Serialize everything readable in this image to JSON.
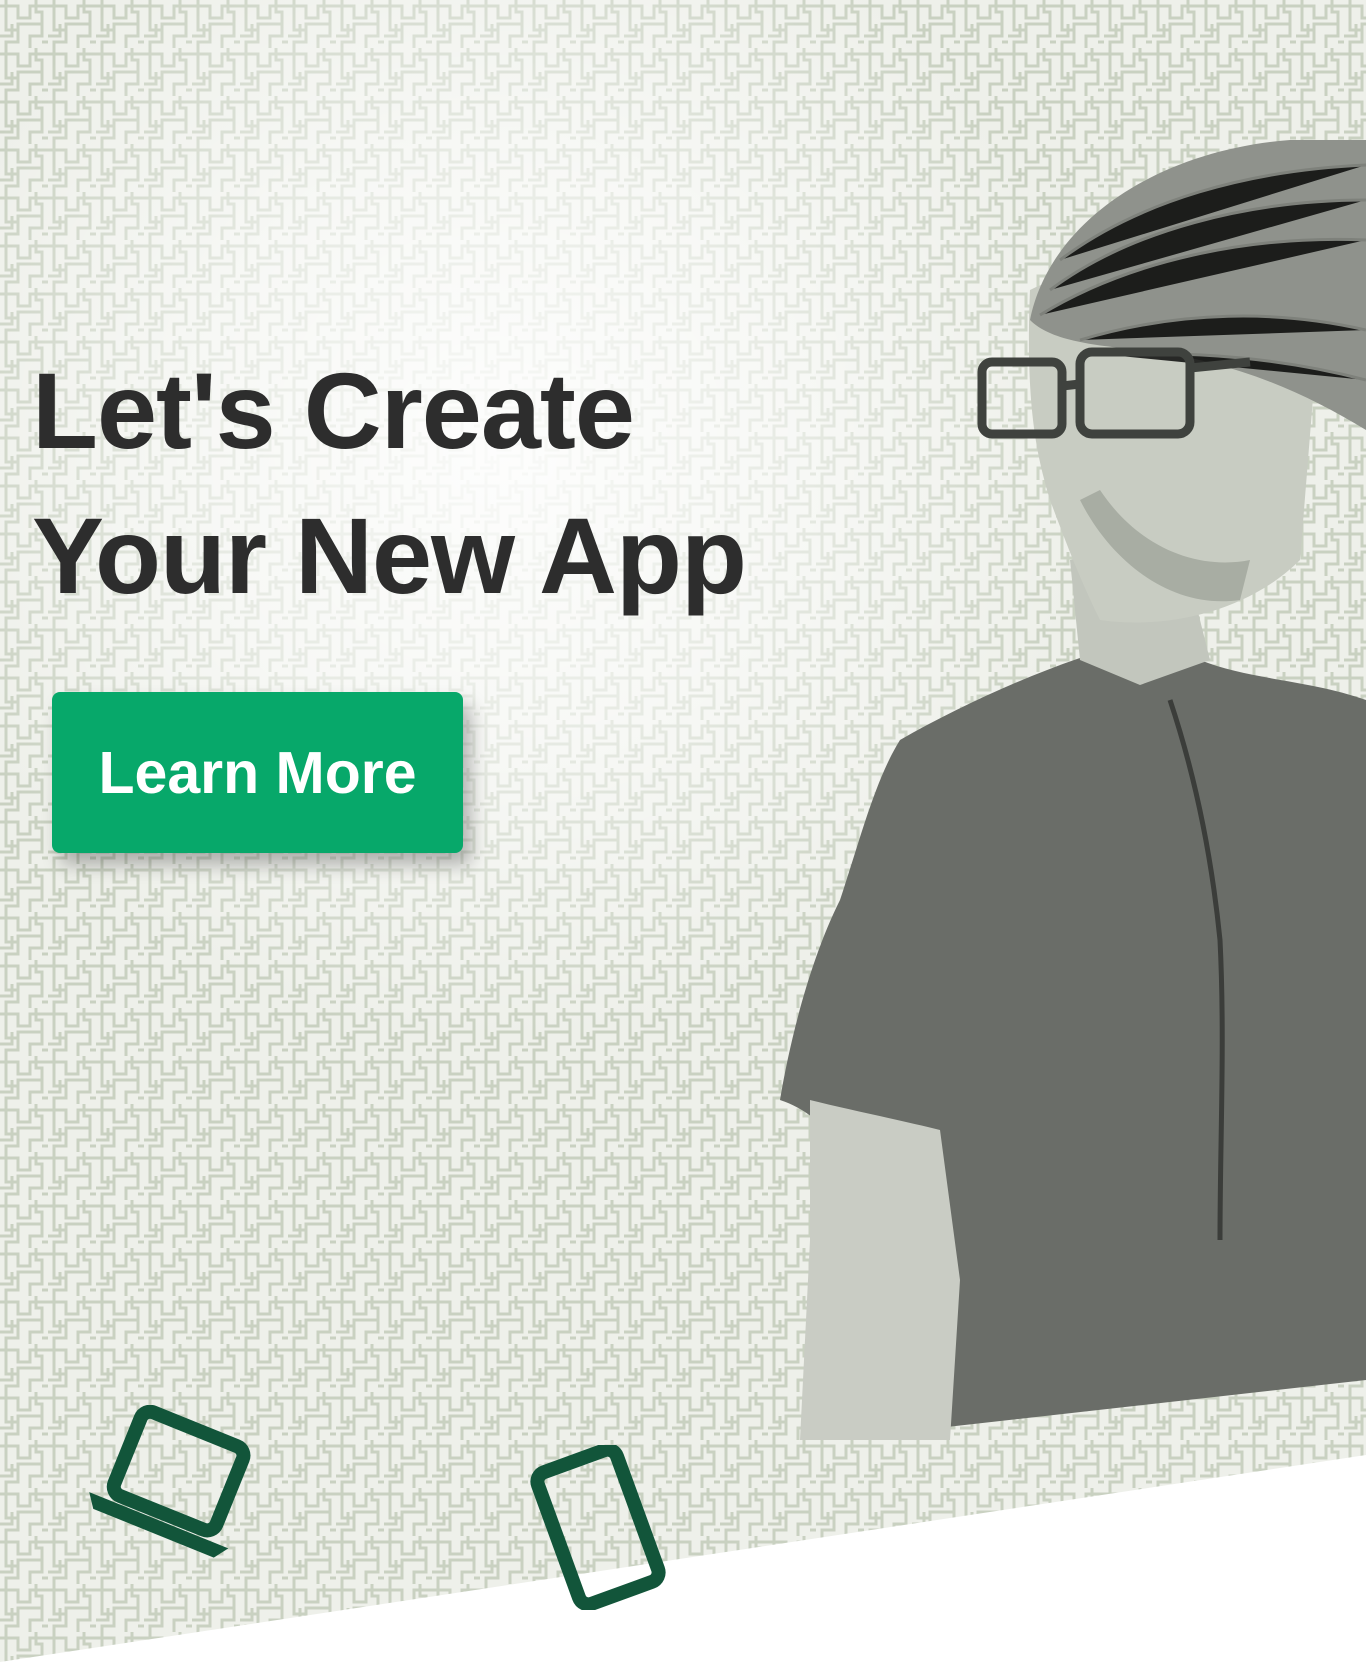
{
  "hero": {
    "headline_line1": "Let's Create",
    "headline_line2": "Your New App",
    "cta_label": "Learn More"
  },
  "icons": [
    "laptop-icon",
    "tablet-icon"
  ],
  "colors": {
    "background": "#eef0ea",
    "maze_line": "#c9d1c1",
    "headline": "#2d2d2d",
    "cta_bg": "#07a86a",
    "cta_text": "#ffffff",
    "icon_green": "#12553a"
  }
}
